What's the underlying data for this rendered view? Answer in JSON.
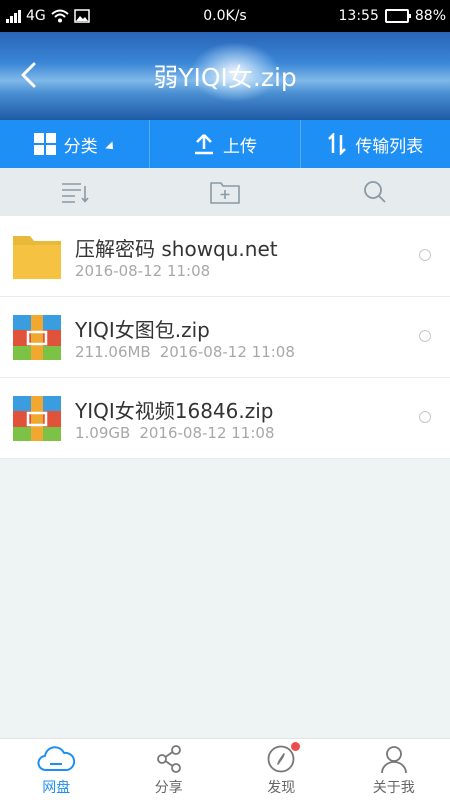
{
  "status_bar": {
    "network": "4G",
    "speed": "0.0K/s",
    "time": "13:55",
    "battery": "88%",
    "battery_level": 0.88
  },
  "header": {
    "title": "弱YIQI女.zip"
  },
  "category_bar": {
    "classify_label": "分类",
    "upload_label": "上传",
    "transfer_label": "传输列表"
  },
  "files": [
    {
      "name": "压解密码 showqu.net",
      "size": "",
      "date": "2016-08-12 11:08",
      "type": "folder"
    },
    {
      "name": "YIQI女图包.zip",
      "size": "211.06MB",
      "date": "2016-08-12 11:08",
      "type": "archive"
    },
    {
      "name": "YIQI女视频16846.zip",
      "size": "1.09GB",
      "date": "2016-08-12 11:08",
      "type": "archive"
    }
  ],
  "bottom_nav": [
    {
      "label": "网盘",
      "icon": "cloud-icon",
      "active": true
    },
    {
      "label": "分享",
      "icon": "share-icon",
      "active": false
    },
    {
      "label": "发现",
      "icon": "compass-icon",
      "active": false
    },
    {
      "label": "关于我",
      "icon": "user-icon",
      "active": false
    }
  ],
  "colors": {
    "accent": "#1e90f5",
    "folder": "#f5c242"
  }
}
